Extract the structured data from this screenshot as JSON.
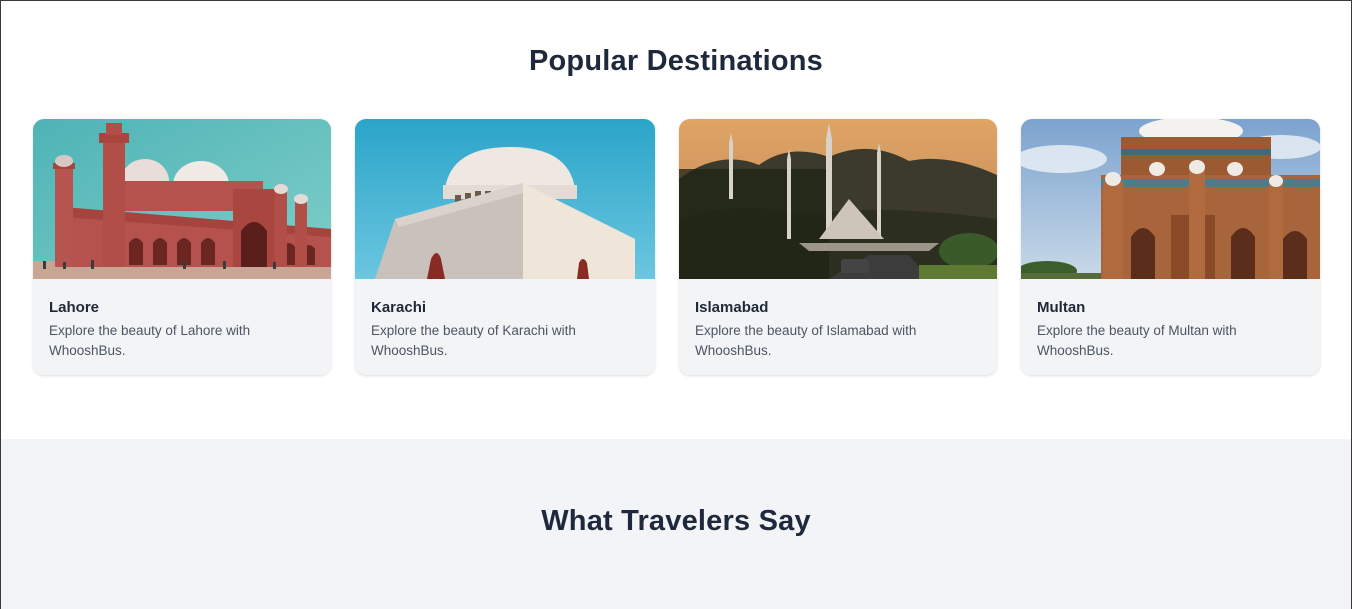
{
  "destinations": {
    "title": "Popular Destinations",
    "cards": [
      {
        "name": "Lahore",
        "description": "Explore the beauty of Lahore with WhooshBus.",
        "image_icon": "badshahi-mosque-image"
      },
      {
        "name": "Karachi",
        "description": "Explore the beauty of Karachi with WhooshBus.",
        "image_icon": "mazar-e-quaid-image"
      },
      {
        "name": "Islamabad",
        "description": "Explore the beauty of Islamabad with WhooshBus.",
        "image_icon": "faisal-mosque-image"
      },
      {
        "name": "Multan",
        "description": "Explore the beauty of Multan with WhooshBus.",
        "image_icon": "shah-rukn-e-alam-image"
      }
    ]
  },
  "testimonials": {
    "title": "What Travelers Say"
  },
  "colors": {
    "heading": "#1e293b",
    "card_bg": "#f3f4f6",
    "section_alt_bg": "#f3f4f8",
    "body_text": "#4b5563"
  }
}
